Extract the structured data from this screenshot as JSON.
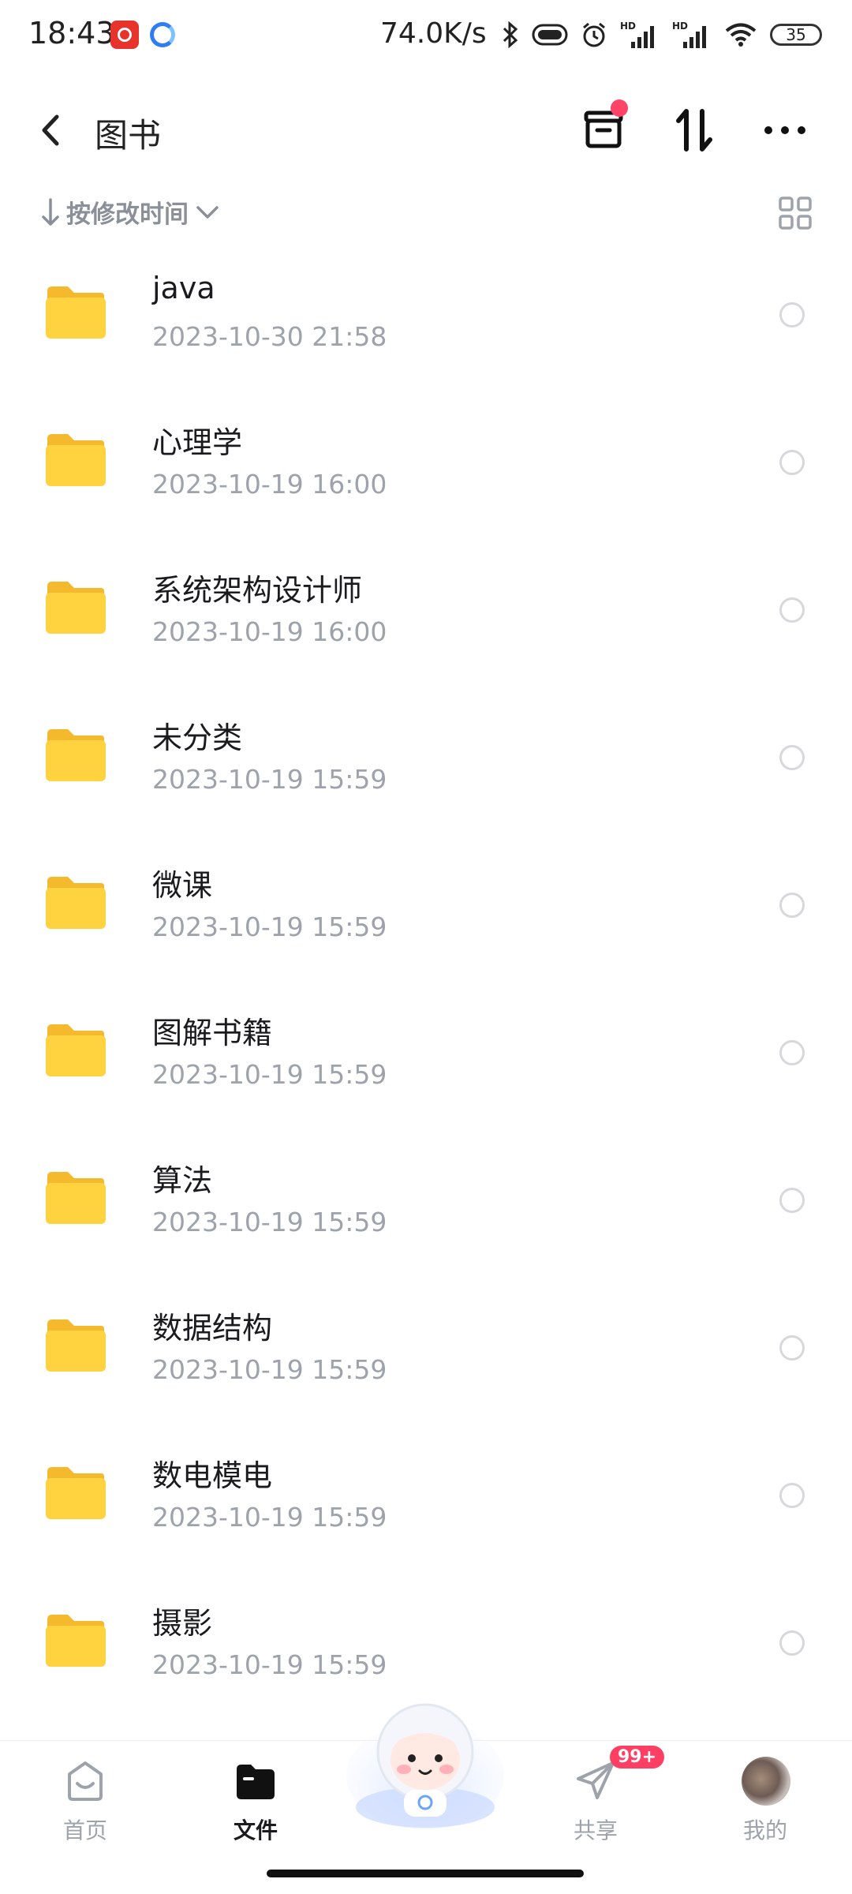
{
  "status_bar": {
    "time": "18:43",
    "net_speed": "74.0K/s",
    "battery": "35",
    "icons": [
      "netease-music-icon",
      "app-icon",
      "bluetooth-icon",
      "vibrate-icon",
      "alarm-icon",
      "hd-signal-icon",
      "hd-signal-icon",
      "wifi-icon",
      "battery-icon"
    ]
  },
  "header": {
    "title": "图书",
    "back_icon": "chevron-left-icon",
    "actions": [
      "transfer-icon",
      "sort-icon",
      "more-icon"
    ]
  },
  "sort": {
    "label": "按修改时间",
    "view_toggle_icon": "grid-icon"
  },
  "files": [
    {
      "name": "java",
      "date": "2023-10-30   21:58"
    },
    {
      "name": "心理学",
      "date": "2023-10-19  16:00"
    },
    {
      "name": "系统架构设计师",
      "date": "2023-10-19  16:00"
    },
    {
      "name": "未分类",
      "date": "2023-10-19  15:59"
    },
    {
      "name": "微课",
      "date": "2023-10-19  15:59"
    },
    {
      "name": "图解书籍",
      "date": "2023-10-19  15:59"
    },
    {
      "name": "算法",
      "date": "2023-10-19  15:59"
    },
    {
      "name": "数据结构",
      "date": "2023-10-19  15:59"
    },
    {
      "name": "数电模电",
      "date": "2023-10-19  15:59"
    },
    {
      "name": "摄影",
      "date": "2023-10-19  15:59"
    }
  ],
  "nav": {
    "home": "首页",
    "files": "文件",
    "share": "共享",
    "share_badge": "99+",
    "me": "我的"
  },
  "colors": {
    "folder": "#ffd23f",
    "badge": "#ff3e63",
    "accent_dot": "#ff4468",
    "muted_text": "#9ea3ab"
  }
}
